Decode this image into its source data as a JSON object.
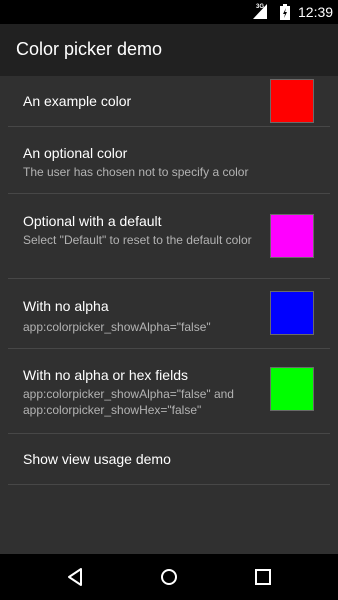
{
  "status_bar": {
    "network": "3G",
    "time": "12:39"
  },
  "app_bar": {
    "title": "Color picker demo"
  },
  "preferences": [
    {
      "title": "An example color",
      "summary": "",
      "swatch_color": "#ff0000"
    },
    {
      "title": "An optional color",
      "summary": "The user has chosen not to specify a color",
      "swatch_color": ""
    },
    {
      "title": "Optional with a default",
      "summary": "Select \"Default\" to reset to the default color",
      "swatch_color": "#ff00ff"
    },
    {
      "title": "With no alpha",
      "summary": "app:colorpicker_showAlpha=\"false\"",
      "swatch_color": "#0000ff"
    },
    {
      "title": "With no alpha or hex fields",
      "summary": "app:colorpicker_showAlpha=\"false\" and app:colorpicker_showHex=\"false\"",
      "swatch_color": "#00ff00"
    },
    {
      "title": "Show view usage demo",
      "summary": "",
      "swatch_color": ""
    }
  ],
  "nav_bar": {
    "icons": [
      "back-icon",
      "home-icon",
      "recents-icon"
    ]
  }
}
